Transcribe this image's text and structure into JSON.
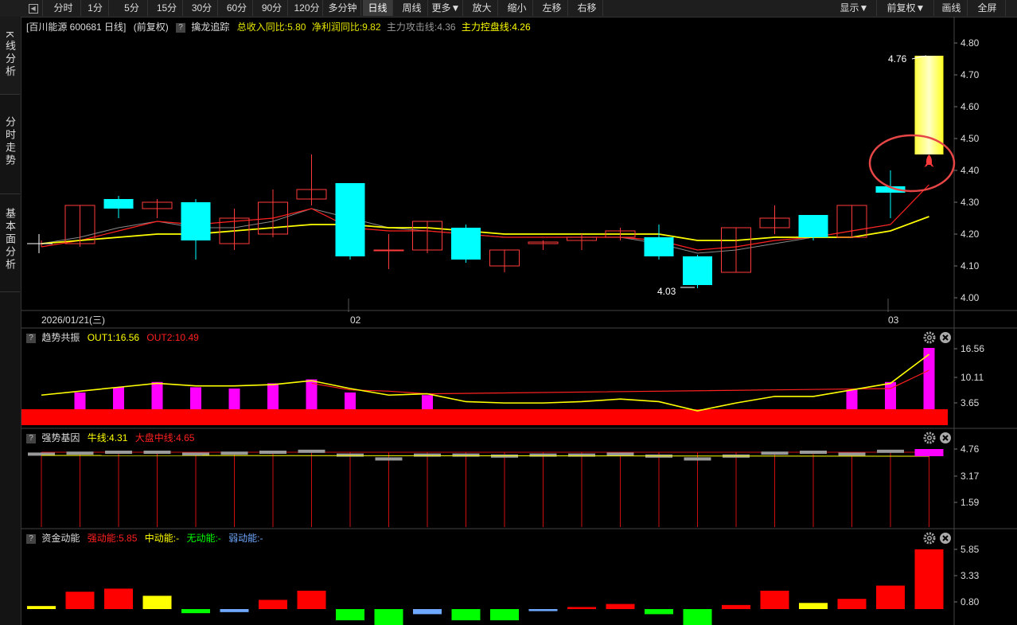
{
  "toolbar": {
    "items": [
      "分时",
      "1分",
      "5分",
      "15分",
      "30分",
      "60分",
      "90分",
      "120分",
      "多分钟",
      "日线",
      "周线",
      "更多▼",
      "放大",
      "缩小",
      "左移",
      "右移"
    ],
    "active": "日线",
    "right_items": [
      "显示▼",
      "前复权▼",
      "画线",
      "全屏"
    ]
  },
  "sidebar": {
    "tabs": [
      "K线分析",
      "分时走势",
      "基本面分析"
    ]
  },
  "main_header": {
    "stock": "[百川能源 600681 日线]",
    "adjust": "(前复权)",
    "q": "?",
    "indicator_name": "擒龙追踪",
    "revenue": "总收入同比:5.80",
    "profit": "净利润同比:9.82",
    "attack": "主力攻击线:4.36",
    "control": "主力控盘线:4.26"
  },
  "price_panel": {
    "y_ticks": [
      "4.80",
      "4.70",
      "4.60",
      "4.50",
      "4.40",
      "4.30",
      "4.20",
      "4.10",
      "4.00"
    ],
    "high_label": "4.76",
    "low_label": "4.03",
    "date_labels": [
      "2026/01/21(三)",
      "02",
      "03"
    ]
  },
  "panel2": {
    "name": "趋势共振",
    "out1": "OUT1:16.56",
    "out2": "OUT2:10.49",
    "y_ticks": [
      "16.56",
      "10.11",
      "3.65"
    ]
  },
  "panel3": {
    "name": "强势基因",
    "bull": "牛线:4.31",
    "market": "大盘中线:4.65",
    "y_ticks": [
      "4.76",
      "3.17",
      "1.59"
    ]
  },
  "panel4": {
    "name": "资金动能",
    "strong": "强动能:5.85",
    "mid": "中动能:-",
    "none": "无动能:-",
    "weak": "弱动能:-",
    "y_ticks": [
      "5.85",
      "3.33",
      "0.80"
    ]
  },
  "colors": {
    "up": "#ff3b3b",
    "down": "#00ffff",
    "ma_yellow": "#ffff00",
    "ma_red": "#ff2020",
    "magenta": "#ff00ff",
    "green": "#00ff00"
  },
  "chart_data": {
    "type": "candlestick",
    "candles": [
      {
        "o": 4.17,
        "h": 4.18,
        "l": 4.16,
        "c": 4.17
      },
      {
        "o": 4.17,
        "h": 4.29,
        "l": 4.16,
        "c": 4.29
      },
      {
        "o": 4.31,
        "h": 4.32,
        "l": 4.25,
        "c": 4.28
      },
      {
        "o": 4.28,
        "h": 4.31,
        "l": 4.25,
        "c": 4.3
      },
      {
        "o": 4.3,
        "h": 4.31,
        "l": 4.12,
        "c": 4.18
      },
      {
        "o": 4.17,
        "h": 4.28,
        "l": 4.15,
        "c": 4.25
      },
      {
        "o": 4.2,
        "h": 4.34,
        "l": 4.19,
        "c": 4.3
      },
      {
        "o": 4.31,
        "h": 4.45,
        "l": 4.29,
        "c": 4.34
      },
      {
        "o": 4.36,
        "h": 4.36,
        "l": 4.12,
        "c": 4.13
      },
      {
        "o": 4.15,
        "h": 4.2,
        "l": 4.09,
        "c": 4.15
      },
      {
        "o": 4.15,
        "h": 4.24,
        "l": 4.14,
        "c": 4.24
      },
      {
        "o": 4.22,
        "h": 4.23,
        "l": 4.11,
        "c": 4.12
      },
      {
        "o": 4.1,
        "h": 4.15,
        "l": 4.08,
        "c": 4.15
      },
      {
        "o": 4.17,
        "h": 4.18,
        "l": 4.15,
        "c": 4.175
      },
      {
        "o": 4.18,
        "h": 4.2,
        "l": 4.15,
        "c": 4.19
      },
      {
        "o": 4.19,
        "h": 4.22,
        "l": 4.18,
        "c": 4.21
      },
      {
        "o": 4.19,
        "h": 4.23,
        "l": 4.12,
        "c": 4.13
      },
      {
        "o": 4.13,
        "h": 4.135,
        "l": 4.03,
        "c": 4.04
      },
      {
        "o": 4.08,
        "h": 4.22,
        "l": 4.08,
        "c": 4.22
      },
      {
        "o": 4.22,
        "h": 4.29,
        "l": 4.2,
        "c": 4.25
      },
      {
        "o": 4.26,
        "h": 4.26,
        "l": 4.18,
        "c": 4.19
      },
      {
        "o": 4.19,
        "h": 4.29,
        "l": 4.19,
        "c": 4.29
      },
      {
        "o": 4.35,
        "h": 4.4,
        "l": 4.25,
        "c": 4.33
      }
    ],
    "ma_yellow": [
      4.17,
      4.18,
      4.19,
      4.2,
      4.2,
      4.21,
      4.22,
      4.23,
      4.23,
      4.22,
      4.22,
      4.21,
      4.2,
      4.2,
      4.2,
      4.2,
      4.2,
      4.18,
      4.18,
      4.19,
      4.19,
      4.19,
      4.21,
      4.255
    ],
    "ma_red": [
      4.16,
      4.18,
      4.21,
      4.24,
      4.23,
      4.24,
      4.25,
      4.28,
      4.22,
      4.21,
      4.21,
      4.2,
      4.19,
      4.19,
      4.19,
      4.19,
      4.18,
      4.15,
      4.16,
      4.18,
      4.19,
      4.21,
      4.23,
      4.355
    ],
    "ma_gray": [
      4.17,
      4.19,
      4.22,
      4.24,
      4.22,
      4.22,
      4.24,
      4.28,
      4.25,
      4.22,
      4.21,
      4.2,
      4.19,
      4.19,
      4.19,
      4.19,
      4.17,
      4.14,
      4.15,
      4.17,
      4.19,
      4.21,
      4.23
    ],
    "forecast_bar": {
      "top": 4.76,
      "bottom": 4.45
    },
    "panel2_out1": [
      1.0,
      2.5,
      4.0,
      5.5,
      4.5,
      4.5,
      5.0,
      6.5,
      3.5,
      1.0,
      1.5,
      -1.5,
      -2.0,
      -2.0,
      -1.5,
      -0.5,
      -1.5,
      -5.0,
      -2.0,
      0.5,
      0.5,
      3.0,
      5.5,
      16.56
    ],
    "panel2_magenta": [
      0,
      2.0,
      4.0,
      6.0,
      4.0,
      3.5,
      5.5,
      7.0,
      2.0,
      0,
      1.0,
      0,
      0,
      0,
      0,
      0,
      0,
      0,
      0,
      0,
      0,
      3.0,
      6.0,
      19.0
    ],
    "panel2_out2": [
      null,
      null,
      null,
      null,
      null,
      null,
      null,
      5.5,
      3.0,
      2.5,
      1.5,
      null,
      null,
      null,
      null,
      null,
      null,
      null,
      null,
      null,
      null,
      null,
      3.5,
      10.49
    ],
    "panel3_gray": [
      4.73,
      4.74,
      4.75,
      4.75,
      4.73,
      4.74,
      4.75,
      4.76,
      4.72,
      4.68,
      4.72,
      4.72,
      4.71,
      4.72,
      4.72,
      4.73,
      4.71,
      4.68,
      4.71,
      4.74,
      4.75,
      4.73,
      4.76
    ],
    "panel4_bars": [
      {
        "v": 0.3,
        "c": "yellow"
      },
      {
        "v": 1.7,
        "c": "red"
      },
      {
        "v": 2.0,
        "c": "red"
      },
      {
        "v": 1.3,
        "c": "yellow"
      },
      {
        "v": -0.4,
        "c": "green"
      },
      {
        "v": -0.3,
        "c": "blue"
      },
      {
        "v": 0.9,
        "c": "red"
      },
      {
        "v": 1.8,
        "c": "red"
      },
      {
        "v": -1.1,
        "c": "green"
      },
      {
        "v": -1.9,
        "c": "green"
      },
      {
        "v": -0.5,
        "c": "blue"
      },
      {
        "v": -1.1,
        "c": "green"
      },
      {
        "v": -1.1,
        "c": "green"
      },
      {
        "v": -0.2,
        "c": "blue"
      },
      {
        "v": 0.2,
        "c": "red"
      },
      {
        "v": 0.5,
        "c": "red"
      },
      {
        "v": -0.5,
        "c": "green"
      },
      {
        "v": -1.9,
        "c": "green"
      },
      {
        "v": 0.4,
        "c": "red"
      },
      {
        "v": 1.8,
        "c": "red"
      },
      {
        "v": 0.6,
        "c": "yellow"
      },
      {
        "v": 1.0,
        "c": "red"
      },
      {
        "v": 2.3,
        "c": "red"
      },
      {
        "v": 5.85,
        "c": "red"
      }
    ]
  }
}
